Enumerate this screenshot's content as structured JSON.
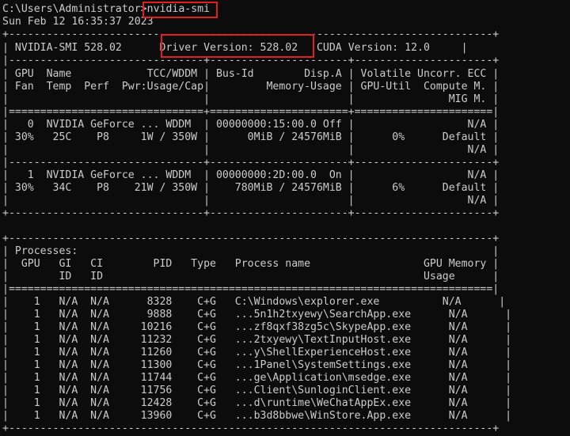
{
  "terminal": {
    "prompt": "C:\\Users\\Administrator>",
    "command": "nvidia-smi",
    "timestamp": "Sun Feb 12 16:35:37 2023"
  },
  "smi_header": {
    "top_border": "+-----------------------------------------------------------------------------+",
    "version_line_left": "| NVIDIA-SMI 528.02      ",
    "driver_version": "Driver Version: 528.02",
    "version_line_right": "   CUDA Version: 12.0     |",
    "sep_dash": "|-------------------------------+----------------------+----------------------+",
    "col_header_1": "| GPU  Name            TCC/WDDM | Bus-Id        Disp.A | Volatile Uncorr. ECC |",
    "col_header_2": "| Fan  Temp  Perf  Pwr:Usage/Cap|         Memory-Usage | GPU-Util  Compute M. |",
    "col_header_3": "|                               |                      |               MIG M. |",
    "sep_eq": "|===============================+======================+======================|"
  },
  "gpus": [
    {
      "line1": "|   0  NVIDIA GeForce ... WDDM  | 00000000:15:00.0 Off |                  N/A |",
      "line2": "| 30%   25C    P8     1W / 350W |      0MiB / 24576MiB |      0%      Default |",
      "line3": "|                               |                      |                  N/A |"
    },
    {
      "line1": "|   1  NVIDIA GeForce ... WDDM  | 00000000:2D:00.0  On |                  N/A |",
      "line2": "| 30%   34C    P8    21W / 350W |    780MiB / 24576MiB |      6%      Default |",
      "line3": "|                               |                      |                  N/A |"
    }
  ],
  "gpu_bottom": "+-------------------------------+----------------------+----------------------+",
  "processes": {
    "top_border": "+-----------------------------------------------------------------------------+",
    "title": "| Processes:                                                                  |",
    "header_1": "|  GPU   GI   CI        PID   Type   Process name                  GPU Memory |",
    "header_2": "|        ID   ID                                                   Usage      |",
    "sep_eq": "|=============================================================================|",
    "rows": [
      "|    1   N/A  N/A      8328    C+G   C:\\Windows\\explorer.exe          N/A      |",
      "|    1   N/A  N/A      9888    C+G   ...5n1h2txyewy\\SearchApp.exe      N/A      |",
      "|    1   N/A  N/A     10216    C+G   ...zf8qxf38zg5c\\SkypeApp.exe      N/A      |",
      "|    1   N/A  N/A     11232    C+G   ...2txyewy\\TextInputHost.exe      N/A      |",
      "|    1   N/A  N/A     11260    C+G   ...y\\ShellExperienceHost.exe      N/A      |",
      "|    1   N/A  N/A     11300    C+G   ...1Panel\\SystemSettings.exe      N/A      |",
      "|    1   N/A  N/A     11744    C+G   ...ge\\Application\\msedge.exe      N/A      |",
      "|    1   N/A  N/A     11756    C+G   ...Client\\SunloginClient.exe      N/A      |",
      "|    1   N/A  N/A     12428    C+G   ...d\\runtime\\WeChatAppEx.exe      N/A      |",
      "|    1   N/A  N/A     13960    C+G   ...b3d8bbwe\\WinStore.App.exe      N/A      |"
    ]
  },
  "colors": {
    "background": "#0c0c0c",
    "text": "#cccccc",
    "highlight": "#e02020"
  }
}
